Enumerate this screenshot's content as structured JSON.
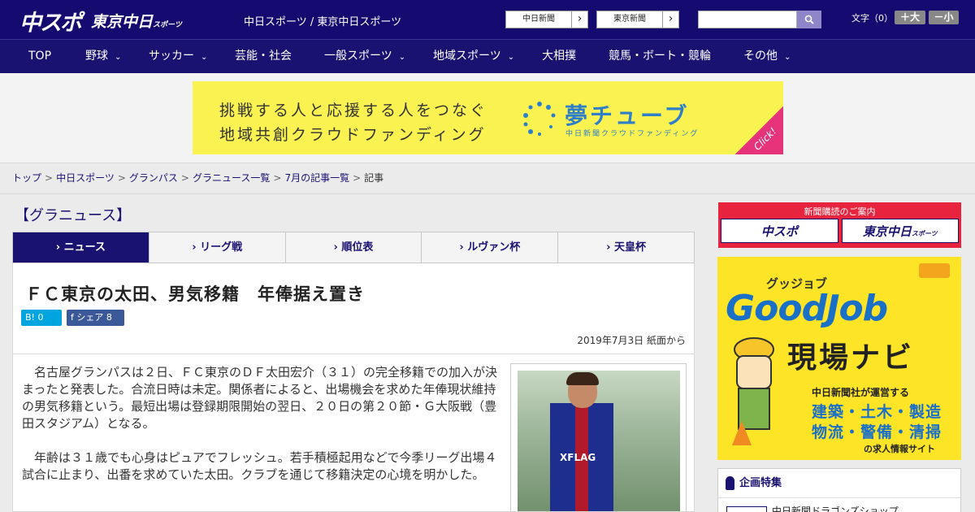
{
  "header": {
    "logo_chuspo": "中スポ",
    "logo_tokyo": "東京中日",
    "logo_tokyo_sub": "スポーツ",
    "site_title": "中日スポーツ / 東京中日スポーツ",
    "link_chunichi": "中日新聞",
    "link_tokyo": "東京新聞",
    "arrow": "›",
    "search_placeholder": "",
    "font_label": "文字（0）",
    "font_plus": "＋大",
    "font_minus": "－小"
  },
  "nav": {
    "items": [
      {
        "label": "TOP",
        "chevron": ""
      },
      {
        "label": "野球",
        "chevron": "⌄"
      },
      {
        "label": "サッカー",
        "chevron": "⌄"
      },
      {
        "label": "芸能・社会",
        "chevron": ""
      },
      {
        "label": "一般スポーツ",
        "chevron": "⌄"
      },
      {
        "label": "地域スポーツ",
        "chevron": "⌄"
      },
      {
        "label": "大相撲",
        "chevron": ""
      },
      {
        "label": "競馬・ボート・競輪",
        "chevron": ""
      },
      {
        "label": "その他",
        "chevron": "⌄"
      }
    ]
  },
  "ad": {
    "line1": "挑戦する人と応援する人をつなぐ",
    "line2": "地域共創クラウドファンディング",
    "brand": "夢チューブ",
    "brand_sub": "中日新聞クラウドファンディング",
    "click": "Click!"
  },
  "breadcrumb": {
    "items": [
      "トップ",
      "中日スポーツ",
      "グランパス",
      "グラニュース一覧",
      "7月の記事一覧"
    ],
    "current": "記事",
    "sep": ">"
  },
  "section_title": "【グラニュース】",
  "tabs": [
    {
      "label": "› ニュース"
    },
    {
      "label": "› リーグ戦"
    },
    {
      "label": "› 順位表"
    },
    {
      "label": "› ルヴァン杯"
    },
    {
      "label": "› 天皇杯"
    }
  ],
  "article": {
    "title": "ＦＣ東京の太田、男気移籍　年俸据え置き",
    "hatena": "B! 0",
    "facebook": "f  シェア 8",
    "date": "2019年7月3日 紙面から",
    "paragraphs": [
      "名古屋グランパスは２日、ＦＣ東京のＤＦ太田宏介（３１）の完全移籍での加入が決まったと発表した。合流日時は未定。関係者によると、出場機会を求めた年俸現状維持の男気移籍という。最短出場は登録期限開始の翌日、２０日の第２０節・Ｇ大阪戦（豊田スタジアム）となる。",
      "年齢は３１歳でも心身はピュアでフレッシュ。若手積極起用などで今季リーグ出場４試合に止まり、出番を求めていた太田。クラブを通じて移籍決定の心境を明かした。"
    ],
    "photo_sponsor": "XFLAG"
  },
  "sidebar": {
    "subscribe_title": "新聞購読のご案内",
    "sub_chuspo": "中スポ",
    "sub_tokyo": "東京中日",
    "sub_tokyo_small": "スポーツ",
    "job_small": "グッジョブ",
    "job_big": "GoodJob",
    "job_navi": "現場ナビ",
    "job_l1": "中日新聞社が運営する",
    "job_l2": "建築・土木・製造",
    "job_l3": "物流・警備・清掃",
    "job_l4": "の求人情報サイト",
    "feature_title": "企画特集",
    "feature_item": "中日新聞ドラゴンズショップ"
  },
  "colors": {
    "header_bg": "#150a70",
    "accent": "#1a1270",
    "ad_bg": "#f9f251",
    "ad_corner": "#e6337a",
    "hatena": "#00a4de",
    "facebook": "#3b5998",
    "subscribe_bg": "#e8233e",
    "job_bg": "#fde426"
  }
}
